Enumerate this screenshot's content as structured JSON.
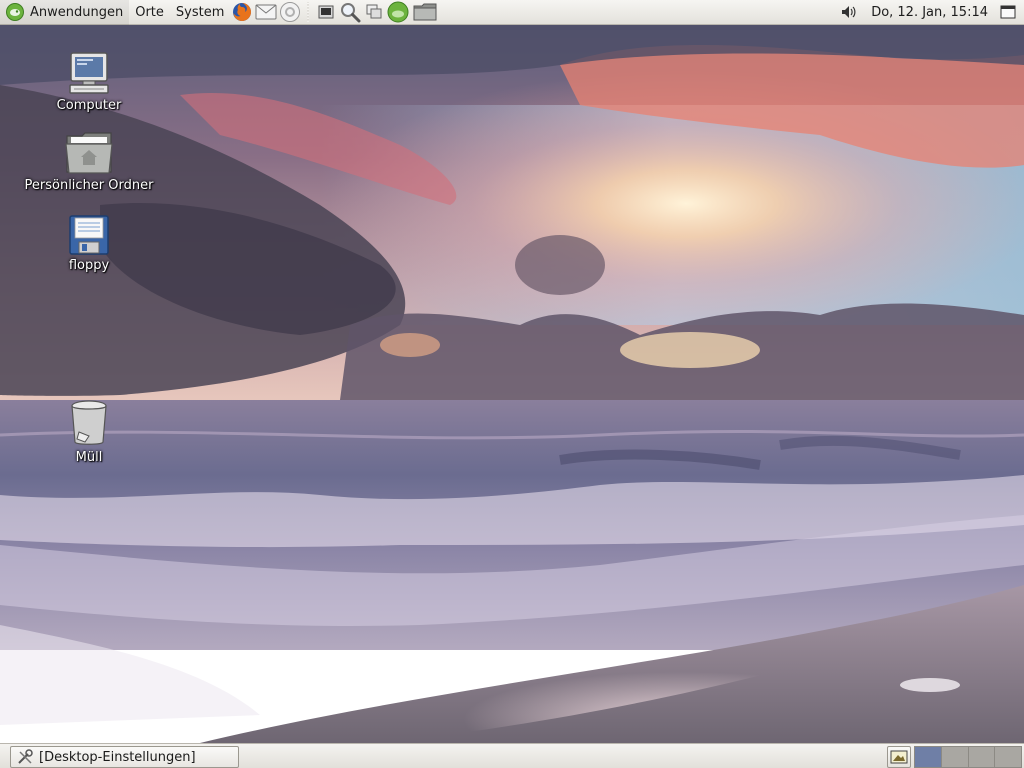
{
  "colors": {
    "panel": "#eeece8",
    "accent_green": "#6cb33e",
    "pager_active": "#6f7fa6",
    "pager_inactive": "#a9a7a2",
    "sky_pink": "#e27f7b",
    "sea": "#6d6f93",
    "sand": "#8f8590"
  },
  "top_panel": {
    "menus": [
      {
        "label": "Anwendungen",
        "icon": "opensuse-logo-icon"
      },
      {
        "label": "Orte"
      },
      {
        "label": "System"
      }
    ],
    "launchers": [
      {
        "name": "firefox-icon"
      },
      {
        "name": "mail-icon"
      },
      {
        "name": "help-icon"
      },
      {
        "name": "terminal-icon"
      },
      {
        "name": "search-icon"
      },
      {
        "name": "windows-icon"
      },
      {
        "name": "software-update-icon"
      },
      {
        "name": "folder-icon"
      }
    ],
    "tray": {
      "volume_icon": "volume-icon",
      "clock": "Do, 12. Jan, 15:14",
      "window_icon": "window-list-icon"
    }
  },
  "desktop": {
    "icons": [
      {
        "label": "Computer",
        "icon": "computer-icon"
      },
      {
        "label": "Persönlicher Ordner",
        "icon": "home-folder-icon"
      },
      {
        "label": "floppy",
        "icon": "floppy-icon"
      },
      {
        "label": "Müll",
        "icon": "trash-icon"
      }
    ]
  },
  "bottom_panel": {
    "task": {
      "label": "[Desktop-Einstellungen]",
      "icon": "settings-tools-icon"
    },
    "show_desktop_icon": "show-desktop-icon",
    "workspaces": 4,
    "active_workspace": 1
  }
}
